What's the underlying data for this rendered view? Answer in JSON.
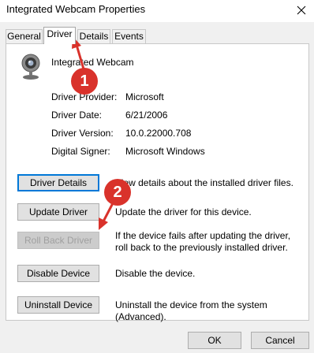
{
  "window": {
    "title": "Integrated Webcam Properties"
  },
  "tabs": [
    {
      "label": "General"
    },
    {
      "label": "Driver"
    },
    {
      "label": "Details"
    },
    {
      "label": "Events"
    }
  ],
  "device": {
    "name": "Integrated Webcam",
    "icon": "webcam-icon"
  },
  "properties": [
    {
      "label": "Driver Provider:",
      "value": "Microsoft"
    },
    {
      "label": "Driver Date:",
      "value": "6/21/2006"
    },
    {
      "label": "Driver Version:",
      "value": "10.0.22000.708"
    },
    {
      "label": "Digital Signer:",
      "value": "Microsoft Windows"
    }
  ],
  "actions": [
    {
      "label": "Driver Details",
      "description": "View details about the installed driver files."
    },
    {
      "label": "Update Driver",
      "description": "Update the driver for this device."
    },
    {
      "label": "Roll Back Driver",
      "description": "If the device fails after updating the driver, roll back to the previously installed driver."
    },
    {
      "label": "Disable Device",
      "description": "Disable the device."
    },
    {
      "label": "Uninstall Device",
      "description": "Uninstall the device from the system (Advanced)."
    }
  ],
  "footer": {
    "ok_label": "OK",
    "cancel_label": "Cancel"
  },
  "annotations": [
    {
      "number": "1"
    },
    {
      "number": "2"
    }
  ],
  "colors": {
    "annotation": "#d9322b",
    "focus": "#0078d7"
  }
}
